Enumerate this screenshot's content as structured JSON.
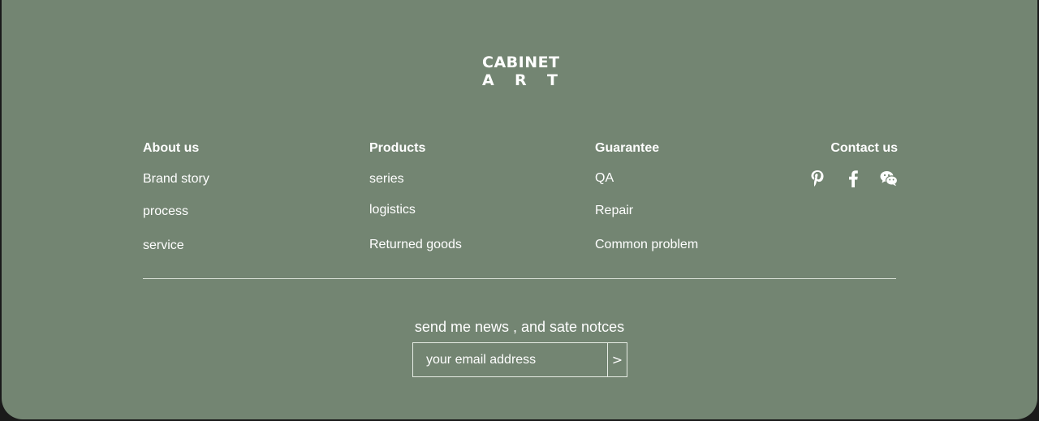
{
  "logo": {
    "line1": "CABINET",
    "line2": [
      "A",
      "R",
      "T"
    ]
  },
  "columns": {
    "about": {
      "title": "About us",
      "links": [
        "Brand story",
        "process",
        "service"
      ]
    },
    "products": {
      "title": "Products",
      "links": [
        "series",
        "logistics",
        "Returned goods"
      ]
    },
    "guarantee": {
      "title": "Guarantee",
      "links": [
        "QA",
        "Repair",
        "Common problem"
      ]
    },
    "contact": {
      "title": "Contact us",
      "social_icons": [
        "pinterest-icon",
        "facebook-icon",
        "wechat-icon"
      ]
    }
  },
  "newsletter": {
    "label": "send me news , and sate notces",
    "placeholder": "your email address",
    "submit_glyph": ">"
  },
  "colors": {
    "background": "#738572",
    "text": "#ffffff",
    "divider": "#d8e0d6"
  }
}
